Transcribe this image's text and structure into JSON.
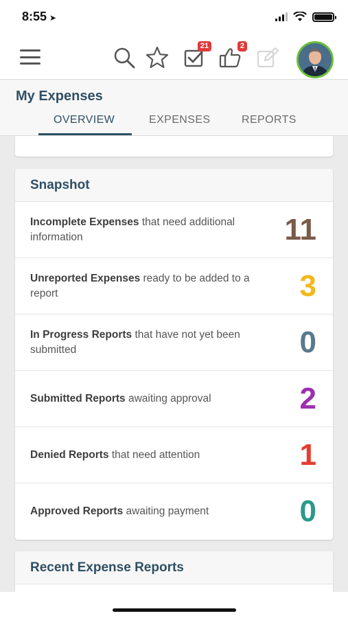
{
  "status": {
    "time": "8:55"
  },
  "toolbar": {
    "approvals_badge": "21",
    "likes_badge": "2"
  },
  "header": {
    "title": "My Expenses",
    "tabs": [
      "OVERVIEW",
      "EXPENSES",
      "REPORTS"
    ],
    "active_tab": "OVERVIEW"
  },
  "snapshot": {
    "title": "Snapshot",
    "rows": [
      {
        "bold": "Incomplete Expenses",
        "text": " that need additional information",
        "count": "11",
        "color": "#7a5a4a"
      },
      {
        "bold": "Unreported Expenses",
        "text": " ready to be added to a report",
        "count": "3",
        "color": "#f2b81c"
      },
      {
        "bold": "In Progress Reports",
        "text": " that have not yet been submitted",
        "count": "0",
        "color": "#587a8c"
      },
      {
        "bold": "Submitted Reports",
        "text": " awaiting approval",
        "count": "2",
        "color": "#9b2fae"
      },
      {
        "bold": "Denied Reports",
        "text": " that need attention",
        "count": "1",
        "color": "#e53d32"
      },
      {
        "bold": "Approved Reports",
        "text": " awaiting payment",
        "count": "0",
        "color": "#2a9a8a"
      }
    ]
  },
  "recent": {
    "title": "Recent Expense Reports"
  }
}
